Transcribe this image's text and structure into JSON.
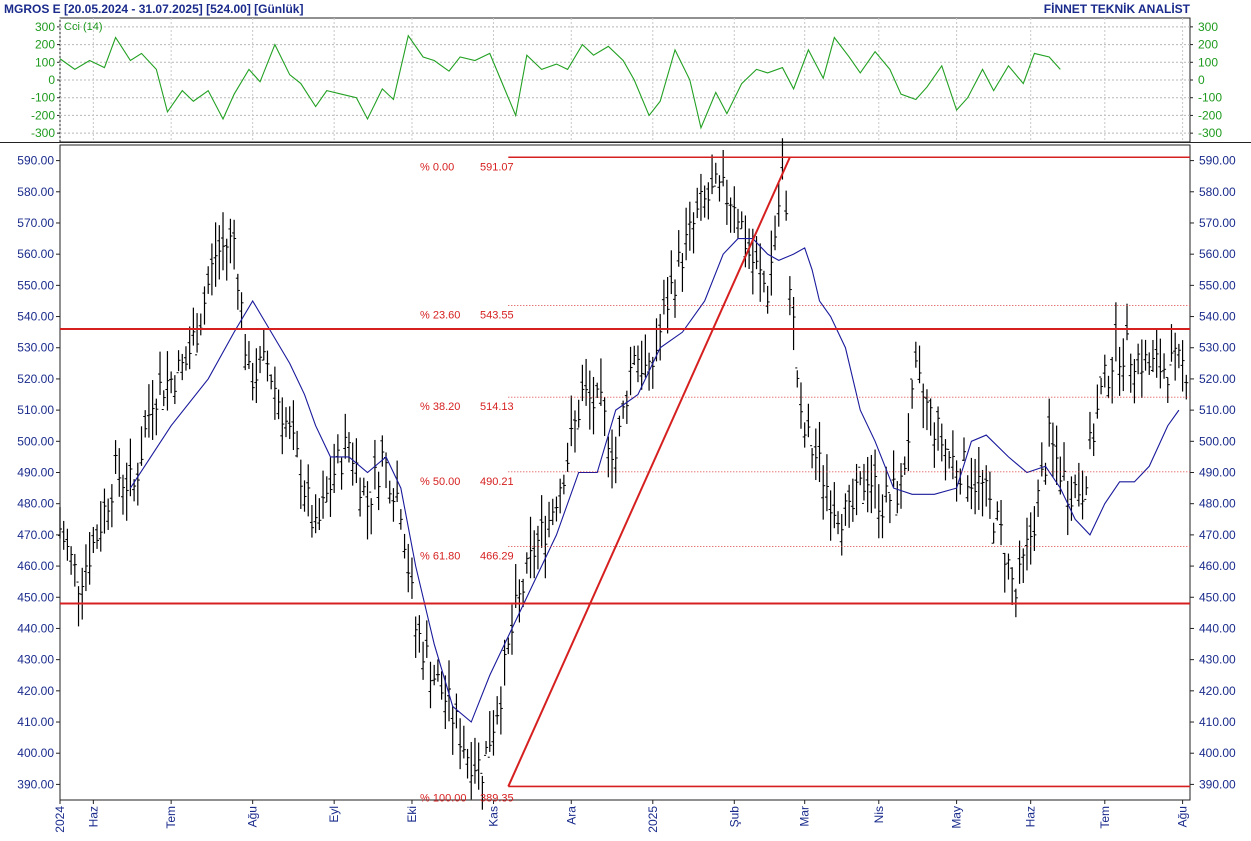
{
  "header": {
    "left": "MGROS E  [20.05.2024 - 31.07.2025]  [524.00]  [Günlük]",
    "right": "FİNNET TEKNİK ANALİST"
  },
  "colors": {
    "price_bars": "#000000",
    "moving_average": "#1a1a9c",
    "cci": "#22a022",
    "levels": "#d62020",
    "axis_text": "#1a2b8c"
  },
  "chart_data": [
    {
      "type": "line",
      "indicator": "Cci (14)",
      "title": "Cci (14)",
      "ylim": [
        -350,
        350
      ],
      "yticks": [
        300,
        200,
        100,
        0,
        -100,
        -200,
        -300
      ],
      "grid": true,
      "x": [
        0,
        4,
        8,
        12,
        15,
        19,
        22,
        26,
        29,
        33,
        36,
        40,
        44,
        47,
        51,
        54,
        58,
        62,
        65,
        69,
        72,
        76,
        80,
        83,
        87,
        90,
        94,
        98,
        101,
        105,
        108,
        112,
        116,
        119,
        123,
        126,
        130,
        134,
        137,
        141,
        144,
        148,
        152,
        155,
        159,
        162,
        166,
        170,
        173,
        177,
        180,
        184,
        188,
        191,
        195,
        198,
        202,
        206,
        209,
        213,
        216,
        220,
        224,
        227,
        231,
        234,
        238,
        242,
        245,
        249,
        252,
        256,
        260,
        263,
        267,
        270
      ],
      "values": [
        120,
        60,
        110,
        70,
        240,
        110,
        150,
        60,
        -180,
        -60,
        -120,
        -60,
        -220,
        -80,
        60,
        -10,
        200,
        30,
        -20,
        -150,
        -60,
        -80,
        -100,
        -220,
        -50,
        -110,
        250,
        130,
        110,
        50,
        130,
        110,
        150,
        0,
        -200,
        140,
        60,
        90,
        60,
        200,
        140,
        190,
        110,
        0,
        -200,
        -120,
        170,
        0,
        -270,
        -70,
        -190,
        -20,
        60,
        40,
        70,
        -50,
        170,
        10,
        240,
        130,
        40,
        160,
        60,
        -80,
        -110,
        -40,
        80,
        -170,
        -100,
        60,
        -60,
        80,
        -20,
        150,
        130,
        60
      ]
    },
    {
      "type": "bar",
      "style": "ohlc",
      "title": "",
      "ylim": [
        385,
        595
      ],
      "yticks": [
        590,
        580,
        570,
        560,
        550,
        540,
        530,
        520,
        510,
        500,
        490,
        480,
        470,
        460,
        450,
        440,
        430,
        420,
        410,
        400,
        390
      ],
      "grid": false,
      "x_tick_labels": [
        "2024",
        "Haz",
        "Tem",
        "Ağu",
        "Eyl",
        "Eki",
        "Kas",
        "Ara",
        "2025",
        "Şub",
        "Mar",
        "Nis",
        "May",
        "Haz",
        "Tem",
        "Ağu"
      ],
      "x_tick_days": [
        0,
        9,
        30,
        52,
        74,
        95,
        117,
        138,
        160,
        182,
        201,
        221,
        242,
        262,
        282,
        303
      ],
      "x_day_range": [
        0,
        305
      ],
      "x": [
        0,
        5,
        10,
        15,
        20,
        25,
        30,
        34,
        38,
        42,
        47,
        51,
        56,
        60,
        65,
        69,
        74,
        78,
        83,
        87,
        92,
        96,
        101,
        105,
        110,
        114,
        119,
        123,
        128,
        132,
        137,
        141,
        146,
        150,
        155,
        159,
        164,
        168,
        173,
        177,
        182,
        186,
        191,
        195,
        200,
        204,
        209,
        213,
        218,
        222,
        227,
        231,
        236,
        240,
        245,
        249,
        254,
        258,
        263,
        267,
        272,
        276,
        281,
        285,
        290,
        294,
        299,
        302
      ],
      "close": [
        472,
        455,
        470,
        490,
        485,
        515,
        520,
        525,
        540,
        560,
        565,
        520,
        525,
        510,
        490,
        470,
        490,
        500,
        480,
        495,
        480,
        440,
        425,
        415,
        400,
        395,
        420,
        445,
        465,
        475,
        495,
        515,
        510,
        495,
        530,
        520,
        545,
        560,
        575,
        580,
        578,
        560,
        548,
        585,
        505,
        495,
        480,
        475,
        490,
        480,
        485,
        520,
        505,
        495,
        490,
        485,
        470,
        450,
        475,
        500,
        485,
        485,
        515,
        530,
        528,
        524,
        524,
        524
      ],
      "series": [
        {
          "name": "",
          "style": "simple-moving-average",
          "x": [
            19,
            30,
            40,
            47,
            52,
            57,
            62,
            66,
            69,
            73,
            78,
            83,
            88,
            92,
            96,
            101,
            106,
            111,
            116,
            122,
            128,
            134,
            140,
            145,
            150,
            156,
            162,
            168,
            174,
            179,
            183,
            187,
            191,
            194,
            198,
            201,
            203,
            205,
            208,
            212,
            216,
            220,
            225,
            230,
            236,
            242,
            246,
            250,
            256,
            261,
            266,
            270,
            274,
            278,
            282,
            286,
            290,
            294,
            299,
            302
          ],
          "values": [
            485,
            505,
            520,
            535,
            545,
            535,
            525,
            515,
            505,
            495,
            495,
            490,
            495,
            485,
            460,
            435,
            415,
            410,
            425,
            440,
            455,
            470,
            490,
            490,
            510,
            515,
            530,
            535,
            545,
            560,
            565,
            565,
            560,
            558,
            560,
            562,
            555,
            545,
            540,
            530,
            510,
            500,
            485,
            483,
            483,
            485,
            500,
            502,
            495,
            490,
            492,
            485,
            475,
            470,
            480,
            487,
            487,
            492,
            505,
            510
          ]
        }
      ],
      "horizontal_levels": [
        536,
        448
      ],
      "trend_line": {
        "from": {
          "x": 121,
          "y": 389.35
        },
        "to": {
          "x": 197,
          "y": 591.07
        }
      },
      "fibonacci": {
        "from_x": 121,
        "levels": [
          {
            "label": "% 0.00",
            "value": 591.07
          },
          {
            "label": "% 23.60",
            "value": 543.55
          },
          {
            "label": "% 38.20",
            "value": 514.13
          },
          {
            "label": "% 50.00",
            "value": 490.21
          },
          {
            "label": "% 61.80",
            "value": 466.29
          },
          {
            "label": "% 100.00",
            "value": 389.35
          }
        ]
      }
    }
  ]
}
